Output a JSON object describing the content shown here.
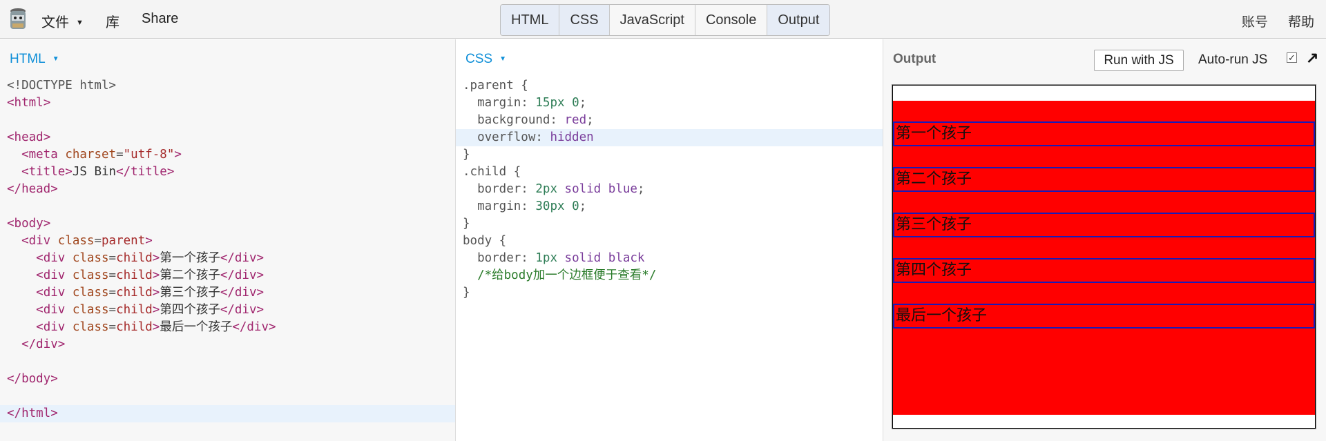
{
  "topbar": {
    "menu": {
      "file": "文件",
      "library": "库",
      "share": "Share"
    },
    "tabs": [
      "HTML",
      "CSS",
      "JavaScript",
      "Console",
      "Output"
    ],
    "account": "账号",
    "help": "帮助"
  },
  "html_panel": {
    "label": "HTML",
    "lines": [
      "<!DOCTYPE html>",
      "<html>",
      "",
      "<head>",
      "  <meta charset=\"utf-8\">",
      "  <title>JS Bin</title>",
      "</head>",
      "",
      "<body>",
      "  <div class=parent>",
      "    <div class=child>第一个孩子</div>",
      "    <div class=child>第二个孩子</div>",
      "    <div class=child>第三个孩子</div>",
      "    <div class=child>第四个孩子</div>",
      "    <div class=child>最后一个孩子</div>",
      "  </div>",
      "",
      "</body>",
      "",
      "</html>"
    ]
  },
  "css_panel": {
    "label": "CSS",
    "lines": [
      ".parent {",
      "  margin: 15px 0;",
      "  background: red;",
      "  overflow: hidden",
      "}",
      ".child {",
      "  border: 2px solid blue;",
      "  margin: 30px 0;",
      "}",
      "body {",
      "  border: 1px solid black",
      "  /*给body加一个边框便于查看*/",
      "}"
    ]
  },
  "output_panel": {
    "label": "Output",
    "run_button": "Run with JS",
    "autorun_label": "Auto-run JS",
    "autorun_checked": true,
    "children": [
      "第一个孩子",
      "第二个孩子",
      "第三个孩子",
      "第四个孩子",
      "最后一个孩子"
    ]
  },
  "colors": {
    "accent": "#0f8fd8",
    "parent_bg": "#ff0000",
    "child_border": "#1a1ab8"
  }
}
